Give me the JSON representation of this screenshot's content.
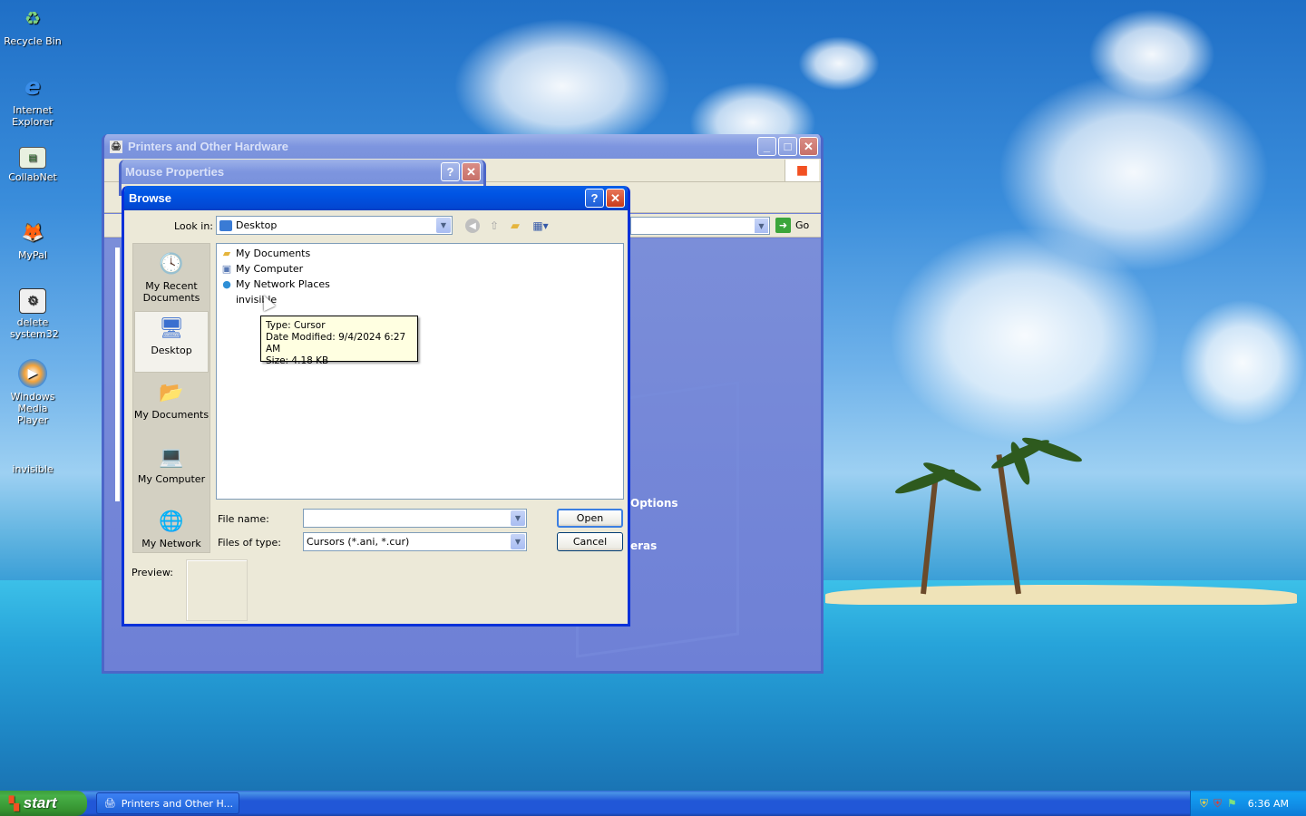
{
  "desktop": {
    "icons": [
      {
        "label": "Recycle Bin",
        "icon": "recycle-bin-icon"
      },
      {
        "label": "Internet Explorer",
        "icon": "internet-explorer-icon"
      },
      {
        "label": "CollabNet",
        "icon": "collabnet-icon"
      },
      {
        "label": "MyPal",
        "icon": "mypal-icon"
      },
      {
        "label": "delete system32",
        "icon": "shortcut-icon"
      },
      {
        "label": "Windows Media Player",
        "icon": "media-player-icon"
      },
      {
        "label": "invisible",
        "icon": "invisible-file-icon"
      }
    ]
  },
  "printers_window": {
    "title": "Printers and Other Hardware",
    "go_label": "Go",
    "partial_options": "Options",
    "partial_eras": "eras"
  },
  "mouse_window": {
    "title": "Mouse Properties"
  },
  "browse": {
    "title": "Browse",
    "look_in_label": "Look in:",
    "look_in_value": "Desktop",
    "places": [
      {
        "label": "My Recent Documents",
        "icon": "recent-documents-icon"
      },
      {
        "label": "Desktop",
        "icon": "desktop-icon"
      },
      {
        "label": "My Documents",
        "icon": "my-documents-icon"
      },
      {
        "label": "My Computer",
        "icon": "my-computer-icon"
      },
      {
        "label": "My Network",
        "icon": "my-network-icon"
      }
    ],
    "files": [
      {
        "name": "My Documents",
        "icon": "folder-icon"
      },
      {
        "name": "My Computer",
        "icon": "computer-icon"
      },
      {
        "name": "My Network Places",
        "icon": "network-icon"
      },
      {
        "name": "invisible",
        "icon": "cursor-file-icon"
      }
    ],
    "tooltip": {
      "type": "Type: Cursor",
      "modified": "Date Modified: 9/4/2024 6:27 AM",
      "size": "Size: 4.18 KB"
    },
    "file_name_label": "File name:",
    "file_name_value": "",
    "files_of_type_label": "Files of type:",
    "files_of_type_value": "Cursors (*.ani, *.cur)",
    "open_label": "Open",
    "cancel_label": "Cancel",
    "preview_label": "Preview:"
  },
  "taskbar": {
    "start_label": "start",
    "task_label": "Printers and Other H...",
    "clock": "6:36 AM"
  },
  "colors": {
    "xp_blue": "#0055e5",
    "close_red": "#c93a1b",
    "dialog_bg": "#ece9d8"
  }
}
